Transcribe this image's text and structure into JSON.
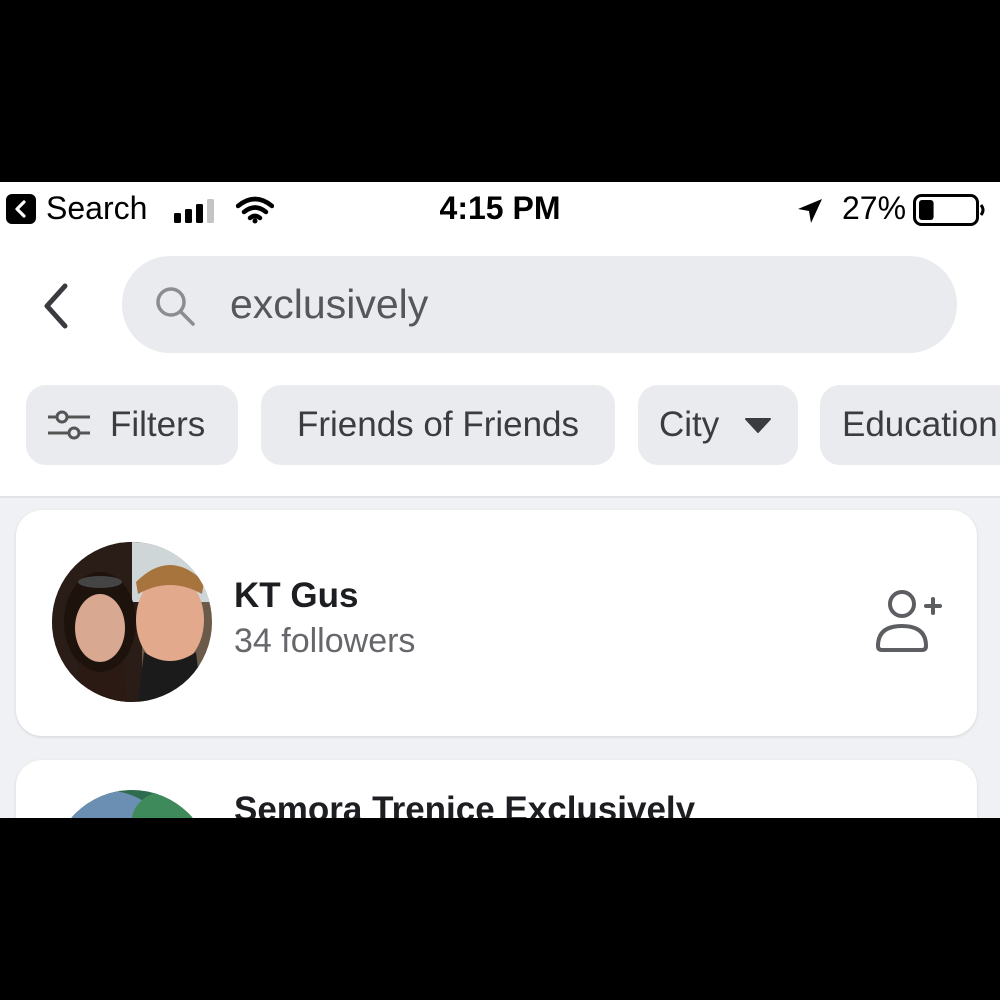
{
  "status_bar": {
    "back_app_label": "Search",
    "time": "4:15 PM",
    "battery_percent": "27%",
    "battery_level": 0.27
  },
  "search": {
    "query": "exclusively"
  },
  "filters": {
    "chips": [
      {
        "label": "Filters"
      },
      {
        "label": "Friends of Friends"
      },
      {
        "label": "City"
      },
      {
        "label": "Education"
      }
    ]
  },
  "results": [
    {
      "name": "KT Gus",
      "subtitle": "34 followers"
    },
    {
      "name": "Semora Trenice Exclusively",
      "subtitle": ""
    }
  ]
}
